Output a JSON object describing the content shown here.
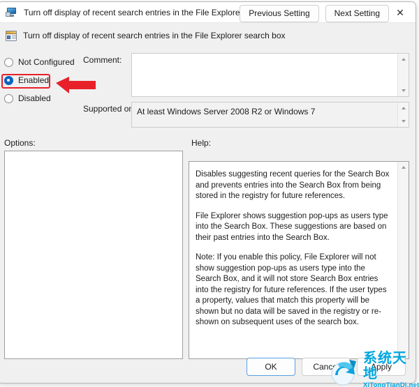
{
  "window": {
    "title": "Turn off display of recent search entries in the File Explorer search box",
    "icon": "monitor-policy-icon",
    "controls": {
      "minimize": "−",
      "maximize": "□",
      "close": "✕"
    }
  },
  "header": {
    "icon": "group-policy-setting-icon",
    "title": "Turn off display of recent search entries in the File Explorer search box",
    "previous_label": "Previous Setting",
    "next_label": "Next Setting"
  },
  "state": {
    "options": [
      {
        "id": "not-configured",
        "label": "Not Configured",
        "selected": false
      },
      {
        "id": "enabled",
        "label": "Enabled",
        "selected": true
      },
      {
        "id": "disabled",
        "label": "Disabled",
        "selected": false
      }
    ],
    "highlight_color": "#e8202a",
    "highlighted_option": "Enabled"
  },
  "comment": {
    "label": "Comment:",
    "value": "",
    "placeholder": ""
  },
  "supported": {
    "label": "Supported on:",
    "value": "At least Windows Server 2008 R2 or Windows 7"
  },
  "panels": {
    "options_label": "Options:",
    "help_label": "Help:"
  },
  "help": {
    "paragraphs": [
      "Disables suggesting recent queries for the Search Box and prevents entries into the Search Box from being stored in the registry for future references.",
      "File Explorer shows suggestion pop-ups as users type into the Search Box.  These suggestions are based on their past entries into the Search Box.",
      "Note: If you enable this policy, File Explorer will not show suggestion pop-ups as users type into the Search Box, and it will not store Search Box entries into the registry for future references.  If the user types a property, values that match this property will be shown but no data will be saved in the registry or re-shown on subsequent uses of the search box."
    ]
  },
  "footer": {
    "ok_label": "OK",
    "cancel_label": "Cancel",
    "apply_label": "Apply"
  },
  "watermark": {
    "chinese": "系统天地",
    "domain": "XiTongTianDi.net",
    "color": "#00a7e0"
  }
}
